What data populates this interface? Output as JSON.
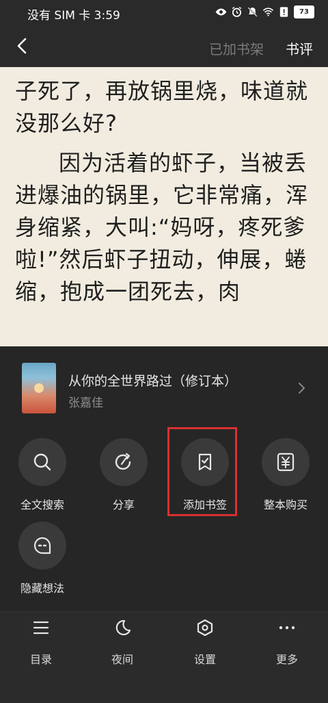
{
  "status_bar": {
    "time": "没有 SIM 卡 3:59",
    "battery": "73",
    "icons": [
      "eye-icon",
      "alarm-icon",
      "mute-icon",
      "wifi-icon",
      "alert-icon",
      "battery-icon"
    ]
  },
  "topbar": {
    "back_icon": "chevron-left-icon",
    "shelf_label": "已加书架",
    "review_label": "书评"
  },
  "reader": {
    "paragraph_1": "子死了，再放锅里烧，味道就没那么好?",
    "paragraph_2": "因为活着的虾子，当被丢进爆油的锅里，它非常痛，浑身缩紧，大叫:“妈呀，疼死爹啦!”然后虾子扭动，伸展，蜷缩，抱成一团死去，肉"
  },
  "book": {
    "title": "从你的全世界路过（修订本）",
    "author": "张嘉佳"
  },
  "actions": [
    {
      "label": "全文搜索",
      "icon": "search-icon"
    },
    {
      "label": "分享",
      "icon": "share-icon"
    },
    {
      "label": "添加书签",
      "icon": "bookmark-check-icon"
    },
    {
      "label": "整本购买",
      "icon": "yuan-icon"
    },
    {
      "label": "隐藏想法",
      "icon": "comment-icon"
    }
  ],
  "bottom_nav": [
    {
      "label": "目录",
      "icon": "menu-icon"
    },
    {
      "label": "夜间",
      "icon": "moon-icon"
    },
    {
      "label": "设置",
      "icon": "settings-icon"
    },
    {
      "label": "更多",
      "icon": "more-icon"
    }
  ],
  "colors": {
    "panel_bg": "#262626",
    "reader_bg": "#f1ecdf",
    "highlight": "#d93030"
  }
}
